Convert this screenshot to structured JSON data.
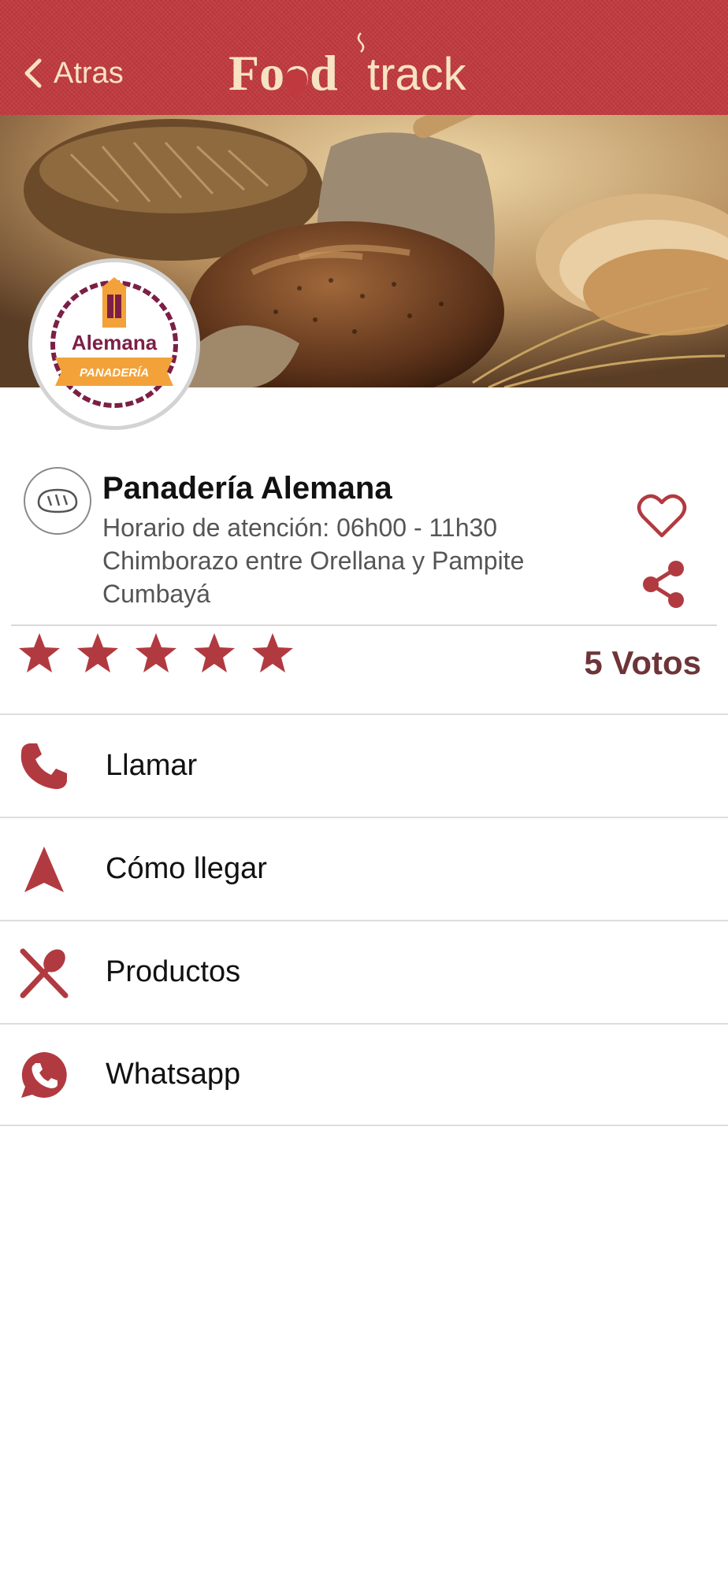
{
  "header": {
    "back_label": "Atras",
    "logo_text_bold": "Food",
    "logo_text_light": "track"
  },
  "brand": {
    "logo_name": "Alemana",
    "logo_ribbon": "PANADERÍA"
  },
  "place": {
    "name": "Panadería Alemana",
    "hours": "Horario de atención: 06h00 - 11h30",
    "address_line1": "Chimborazo entre Orellana y Pampite",
    "address_line2": "Cumbayá",
    "category_icon": "bread-icon"
  },
  "rating": {
    "stars": 5,
    "max_stars": 5,
    "votes_label": "5 Votos"
  },
  "actions": [
    {
      "label": "Llamar",
      "icon": "phone-icon"
    },
    {
      "label": "Cómo llegar",
      "icon": "navigation-arrow-icon"
    },
    {
      "label": "Productos",
      "icon": "utensils-icon"
    },
    {
      "label": "Whatsapp",
      "icon": "whatsapp-icon"
    }
  ],
  "colors": {
    "brand_red": "#c0393f",
    "icon_red": "#b13a40",
    "cream": "#f7e3c4",
    "votes_color": "#6e3438"
  }
}
